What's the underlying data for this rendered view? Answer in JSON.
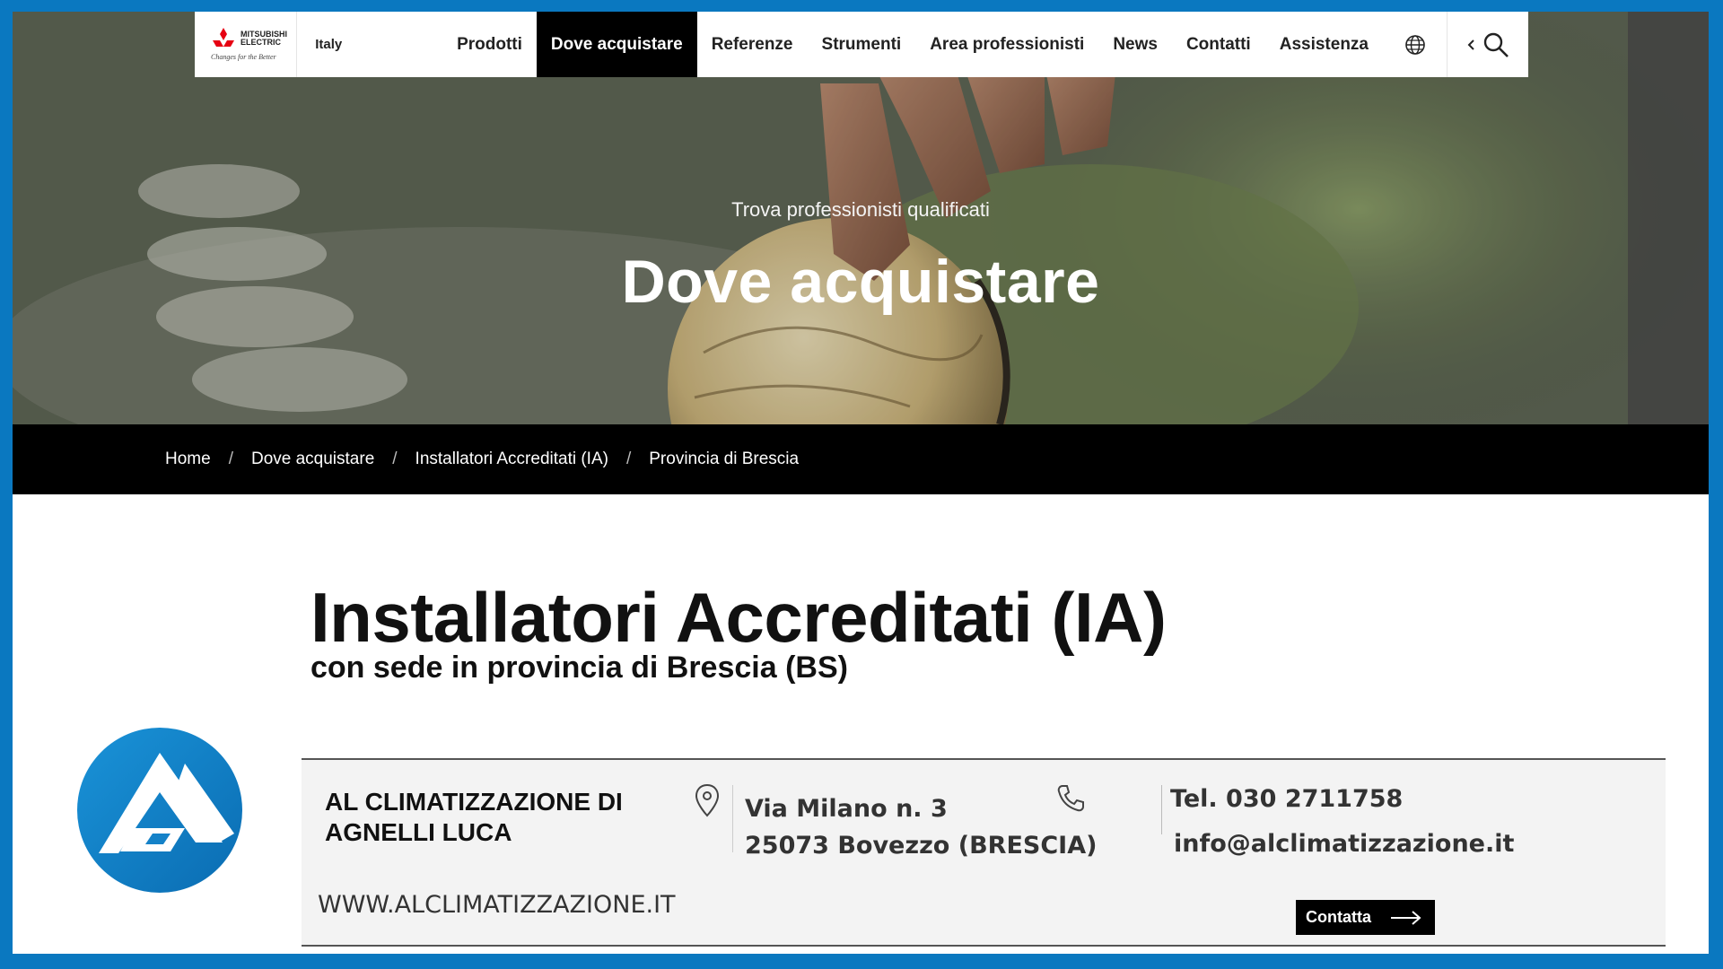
{
  "brand": {
    "name_line1": "MITSUBISHI",
    "name_line2": "ELECTRIC",
    "tagline": "Changes for the Better",
    "color": "#e60012"
  },
  "navbar": {
    "region": "Italy",
    "items": [
      {
        "label": "Prodotti"
      },
      {
        "label": "Dove acquistare",
        "active": true
      },
      {
        "label": "Referenze"
      },
      {
        "label": "Strumenti"
      },
      {
        "label": "Area professionisti"
      },
      {
        "label": "News"
      },
      {
        "label": "Contatti"
      },
      {
        "label": "Assistenza"
      }
    ],
    "icons": [
      "globe-icon",
      "chevron-left-icon",
      "search-icon"
    ]
  },
  "hero": {
    "subtitle": "Trova professionisti qualificati",
    "title": "Dove acquistare"
  },
  "breadcrumb": [
    "Home",
    "Dove acquistare",
    "Installatori Accreditati (IA)",
    "Provincia di Brescia"
  ],
  "page": {
    "title": "Installatori Accreditati (IA)",
    "subtitle": "con sede in provincia di Brescia (BS)"
  },
  "listing": {
    "company_name": "AL CLIMATIZZAZIONE DI AGNELLI LUCA",
    "address_line1": "Via Milano n. 3",
    "address_line2": "25073 Bovezzo (BRESCIA)",
    "phone": "Tel. 030 2711758",
    "email": "info@alclimatizzazione.it",
    "website": "WWW.ALCLIMATIZZAZIONE.IT",
    "contact_label": "Contatta",
    "logo_color": "#0a7cc4"
  },
  "colors": {
    "frame": "#0a78c0",
    "nav_active_bg": "#000000",
    "breadcrumb_bg": "#000000",
    "card_bg": "#f3f3f3"
  }
}
